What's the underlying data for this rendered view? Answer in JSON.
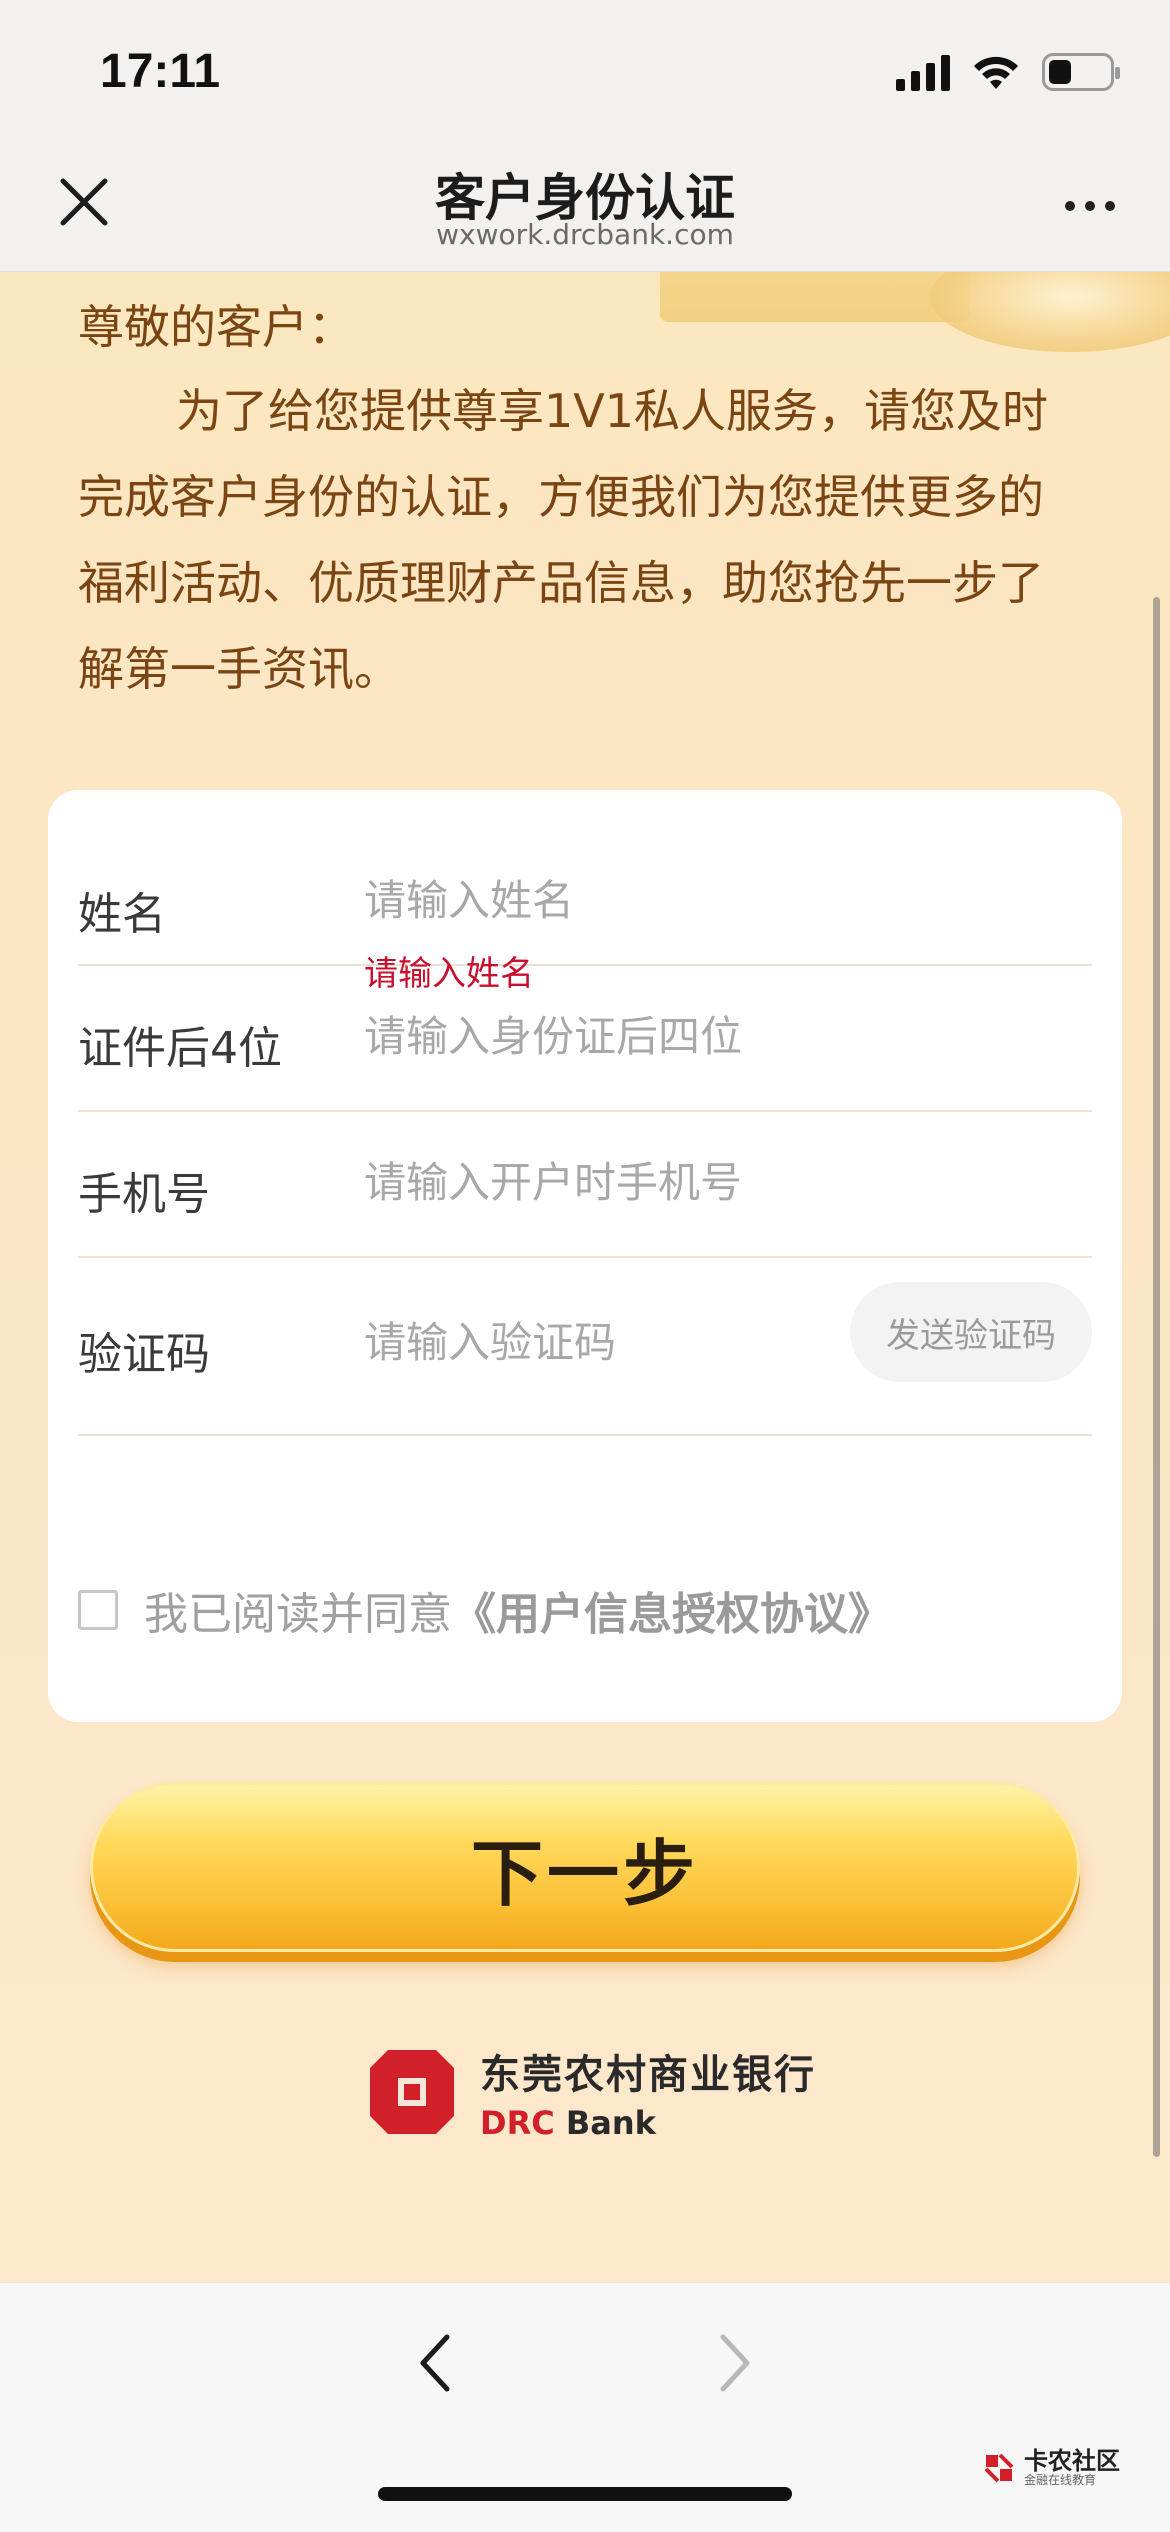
{
  "status_bar": {
    "time": "17:11"
  },
  "nav": {
    "title": "客户身份认证",
    "url": "wxwork.drcbank.com"
  },
  "intro": {
    "greeting": "尊敬的客户：",
    "body": "为了给您提供尊享1V1私人服务，请您及时完成客户身份的认证，方便我们为您提供更多的福利活动、优质理财产品信息，助您抢先一步了解第一手资讯。"
  },
  "form": {
    "name": {
      "label": "姓名",
      "placeholder": "请输入姓名",
      "error": "请输入姓名"
    },
    "id_last4": {
      "label": "证件后4位",
      "placeholder": "请输入身份证后四位"
    },
    "phone": {
      "label": "手机号",
      "placeholder": "请输入开户时手机号"
    },
    "code": {
      "label": "验证码",
      "placeholder": "请输入验证码",
      "send_button": "发送验证码"
    },
    "agreement": {
      "prefix": "我已阅读并同意",
      "link": "《用户信息授权协议》",
      "checked": false
    }
  },
  "next_button": "下一步",
  "bank": {
    "name_cn": "东莞农村商业银行",
    "name_en_prefix": "DRC",
    "name_en_suffix": " Bank",
    "brand_color": "#d1202a"
  },
  "watermark": {
    "main": "卡农社区",
    "sub": "金融在线教育"
  },
  "icons": {
    "close": "close-icon",
    "more": "more-dots-icon",
    "back": "chevron-left-icon",
    "forward": "chevron-right-icon"
  }
}
